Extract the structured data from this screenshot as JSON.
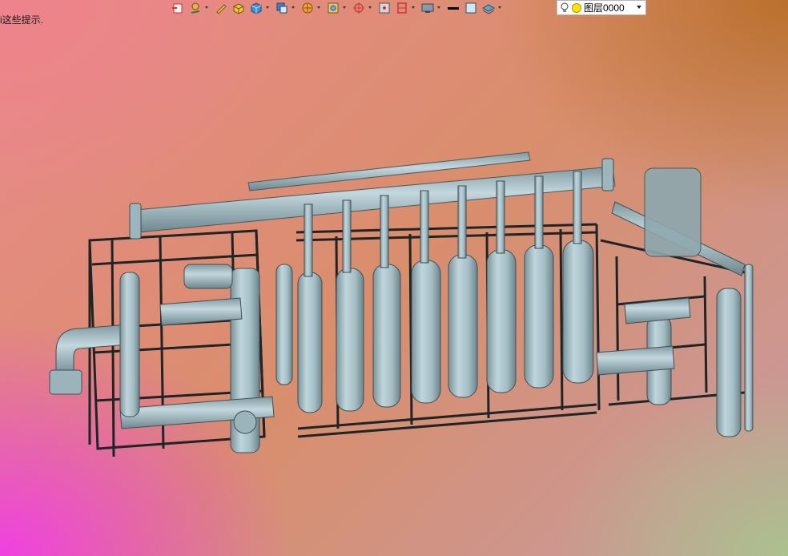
{
  "status": {
    "hint_text": "i这些提示."
  },
  "toolbar": {
    "buttons": [
      {
        "name": "exit-sketch-icon"
      },
      {
        "name": "smart-dimension-icon",
        "has_dropdown": true
      },
      {
        "name": "edit-pencil-icon"
      },
      {
        "name": "extrude-boss-icon"
      },
      {
        "name": "view-cube-icon",
        "has_dropdown": true
      },
      {
        "name": "view-orientation-icon",
        "has_dropdown": true
      },
      {
        "name": "display-style-icon",
        "has_dropdown": true
      },
      {
        "name": "hide-show-icon",
        "has_dropdown": true
      },
      {
        "name": "section-view-icon",
        "has_dropdown": true
      },
      {
        "name": "zoom-area-icon"
      },
      {
        "name": "previous-view-icon",
        "has_dropdown": true
      },
      {
        "name": "monitor-display-icon",
        "has_dropdown": true
      },
      {
        "name": "line-thickness-icon"
      },
      {
        "name": "color-swatch-icon"
      },
      {
        "name": "layer-properties-icon",
        "has_dropdown": true
      }
    ]
  },
  "layer": {
    "selected_value": "图层0000"
  },
  "colors": {
    "pipe": "#a9c2c9",
    "pipe_dark": "#6f8a92",
    "frame": "#2a2f30",
    "hint_text": "#1a1a1a"
  }
}
